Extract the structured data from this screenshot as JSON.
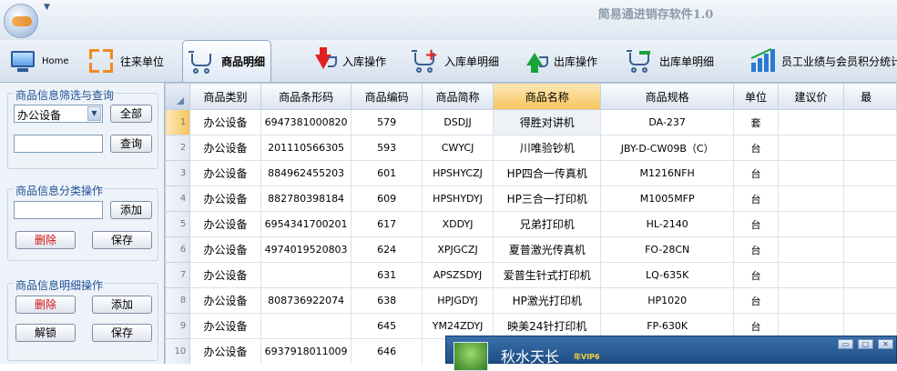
{
  "app": {
    "title": "简易通进销存软件1.0"
  },
  "toolbar": {
    "items": [
      {
        "label": "Home",
        "icon": "monitor-icon"
      },
      {
        "label": "往来单位",
        "icon": "arrows-icon"
      },
      {
        "label": "商品明细",
        "icon": "cart-icon",
        "active": true
      },
      {
        "label": "入库操作",
        "icon": "cart-down-icon"
      },
      {
        "label": "入库单明细",
        "icon": "cart-plus-icon"
      },
      {
        "label": "出库操作",
        "icon": "cart-up-icon"
      },
      {
        "label": "出库单明细",
        "icon": "cart-minus-icon"
      },
      {
        "label": "员工业绩与会员积分统计",
        "icon": "bar-chart-icon"
      }
    ]
  },
  "left": {
    "filter": {
      "title": "商品信息筛选与查询",
      "category_value": "办公设备",
      "all_button": "全部",
      "search_value": "",
      "search_button": "查询"
    },
    "category_ops": {
      "title": "商品信息分类操作",
      "input_value": "",
      "add_button": "添加",
      "delete_button": "删除",
      "save_button": "保存"
    },
    "detail_ops": {
      "title": "商品信息明细操作",
      "delete_button": "删除",
      "add_button": "添加",
      "unlock_button": "解锁",
      "save_button": "保存"
    }
  },
  "grid": {
    "columns": [
      "商品类别",
      "商品条形码",
      "商品编码",
      "商品简称",
      "商品名称",
      "商品规格",
      "单位",
      "建议价",
      "最"
    ],
    "sorted_column": 4,
    "rows": [
      {
        "n": "1",
        "cells": [
          "办公设备",
          "6947381000820",
          "579",
          "DSDJJ",
          "得胜对讲机",
          "DA-237",
          "套",
          "",
          ""
        ]
      },
      {
        "n": "2",
        "cells": [
          "办公设备",
          "201110566305",
          "593",
          "CWYCJ",
          "川唯验钞机",
          "JBY-D-CW09B（C）",
          "台",
          "",
          ""
        ]
      },
      {
        "n": "3",
        "cells": [
          "办公设备",
          "884962455203",
          "601",
          "HPSHYCZJ",
          "HP四合一传真机",
          "M1216NFH",
          "台",
          "",
          ""
        ]
      },
      {
        "n": "4",
        "cells": [
          "办公设备",
          "882780398184",
          "609",
          "HPSHYDYJ",
          "HP三合一打印机",
          "M1005MFP",
          "台",
          "",
          ""
        ]
      },
      {
        "n": "5",
        "cells": [
          "办公设备",
          "6954341700201",
          "617",
          "XDDYJ",
          "兄弟打印机",
          "HL-2140",
          "台",
          "",
          ""
        ]
      },
      {
        "n": "6",
        "cells": [
          "办公设备",
          "4974019520803",
          "624",
          "XPJGCZJ",
          "夏普激光传真机",
          "FO-28CN",
          "台",
          "",
          ""
        ]
      },
      {
        "n": "7",
        "cells": [
          "办公设备",
          "",
          "631",
          "APSZSDYJ",
          "爱普生针式打印机",
          "LQ-635K",
          "台",
          "",
          ""
        ]
      },
      {
        "n": "8",
        "cells": [
          "办公设备",
          "808736922074",
          "638",
          "HPJGDYJ",
          "HP激光打印机",
          "HP1020",
          "台",
          "",
          ""
        ]
      },
      {
        "n": "9",
        "cells": [
          "办公设备",
          "",
          "645",
          "YM24ZDYJ",
          "映美24针打印机",
          "FP-630K",
          "台",
          "",
          ""
        ]
      },
      {
        "n": "10",
        "cells": [
          "办公设备",
          "6937918011009",
          "646",
          "",
          "",
          "",
          "",
          "",
          ""
        ]
      }
    ]
  },
  "popup": {
    "name": "秋水天长",
    "badge": "年VIP6"
  }
}
